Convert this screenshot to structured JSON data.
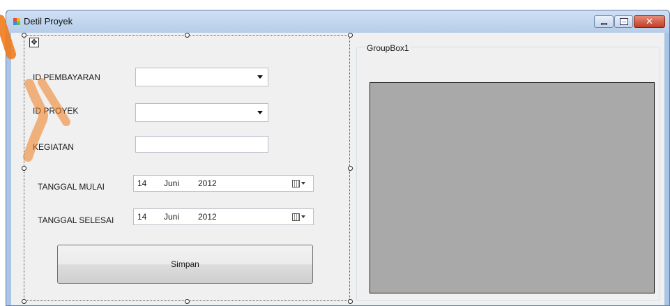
{
  "window": {
    "title": "Detil Proyek"
  },
  "form": {
    "id_pembayaran_label": "ID PEMBAYARAN",
    "id_proyek_label": "ID PROYEK",
    "kegiatan_label": "KEGIATAN",
    "kegiatan_value": "",
    "tanggal_mulai": {
      "label": "TANGGAL MULAI",
      "day": "14",
      "month": "Juni",
      "year": "2012"
    },
    "tanggal_selesai": {
      "label": "TANGGAL SELESAI",
      "day": "14",
      "month": "Juni",
      "year": "2012"
    },
    "save_label": "Simpan"
  },
  "groupbox": {
    "title": "GroupBox1"
  },
  "icons": [
    "app-icon",
    "minimize-icon",
    "maximize-icon",
    "close-icon",
    "move-icon",
    "chevron-down-icon",
    "calendar-icon"
  ],
  "colors": {
    "title_bar": "#b6cde9",
    "client_bg": "#f0f0f0",
    "preview_bg": "#a9a9a9",
    "close_button": "#c23e24"
  }
}
